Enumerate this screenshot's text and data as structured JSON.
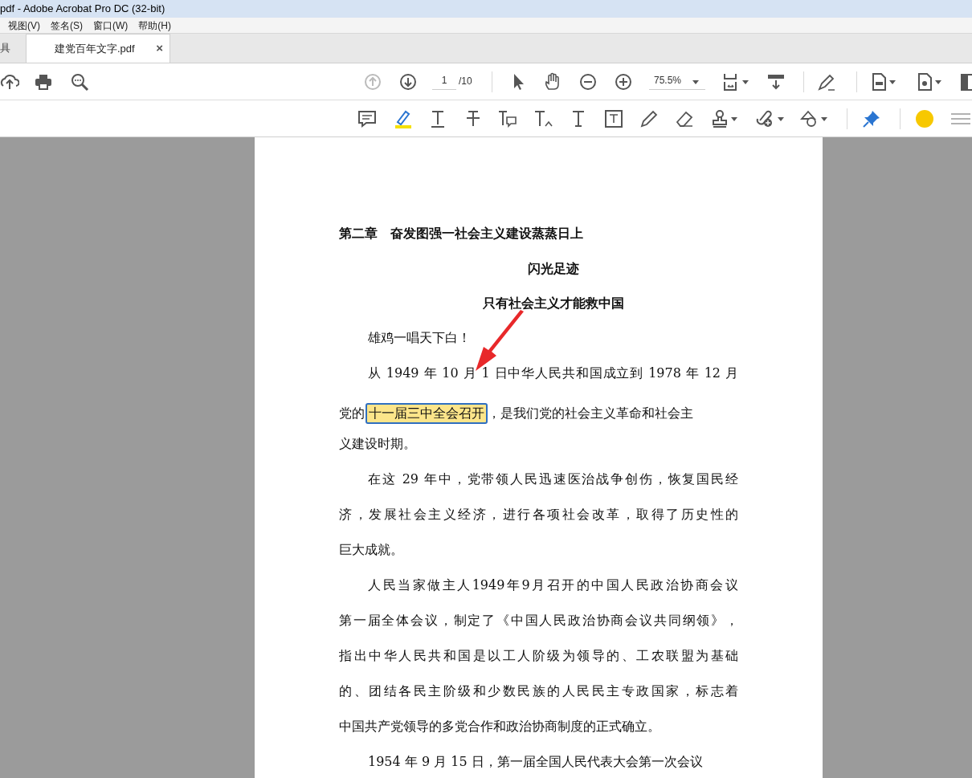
{
  "window": {
    "title": "pdf - Adobe Acrobat Pro DC (32-bit)"
  },
  "menu": [
    "视图(V)",
    "签名(S)",
    "窗口(W)",
    "帮助(H)"
  ],
  "tabs": [
    {
      "label": "具",
      "selected": false
    },
    {
      "label": "建党百年文字.pdf",
      "selected": true,
      "close": "×"
    }
  ],
  "toolbar": {
    "page": "1",
    "page_total": "/10",
    "zoom": "75.5%"
  },
  "document": [
    {
      "kind": "heading",
      "lines": [
        "第二章　奋发图强一社会主义建设蒸蒸日上"
      ]
    },
    {
      "kind": "title",
      "lines": [
        "闪光足迹"
      ]
    },
    {
      "kind": "title",
      "lines": [
        "只有社会主义才能救中国"
      ]
    },
    {
      "kind": "body",
      "lines": [
        "雄鸡一唱天下白！"
      ]
    },
    {
      "kind": "body",
      "lines": [
        "从 1949 年 10 月 1 日中华人民共和国成立到 1978 年 12 月",
        {
          "before": "党的",
          "highlight": "十一届三中全会召开",
          "after": "，是我们党的社会主义革命和社会主"
        },
        "义建设时期。"
      ]
    },
    {
      "kind": "body",
      "lines": [
        "在这 29 年中，党带领人民迅速医治战争创伤，恢复国民经",
        "济，发展社会主义经济，进行各项社会改革，取得了历史性的",
        "巨大成就。"
      ]
    },
    {
      "kind": "body",
      "lines": [
        "人民当家做主人1949年9月召开的中国人民政治协商会议",
        "第一届全体会议，制定了《中国人民政治协商会议共同纲领》，",
        "指出中华人民共和国是以工人阶级为领导的、工农联盟为基础",
        "的、团结各民主阶级和少数民族的人民民主专政国家，标志着",
        "中国共产党领导的多党合作和政治协商制度的正式确立。"
      ]
    },
    {
      "kind": "body",
      "lines": [
        "1954 年 9 月 15 日，第一届全国人民代表大会第一次会议"
      ]
    }
  ]
}
